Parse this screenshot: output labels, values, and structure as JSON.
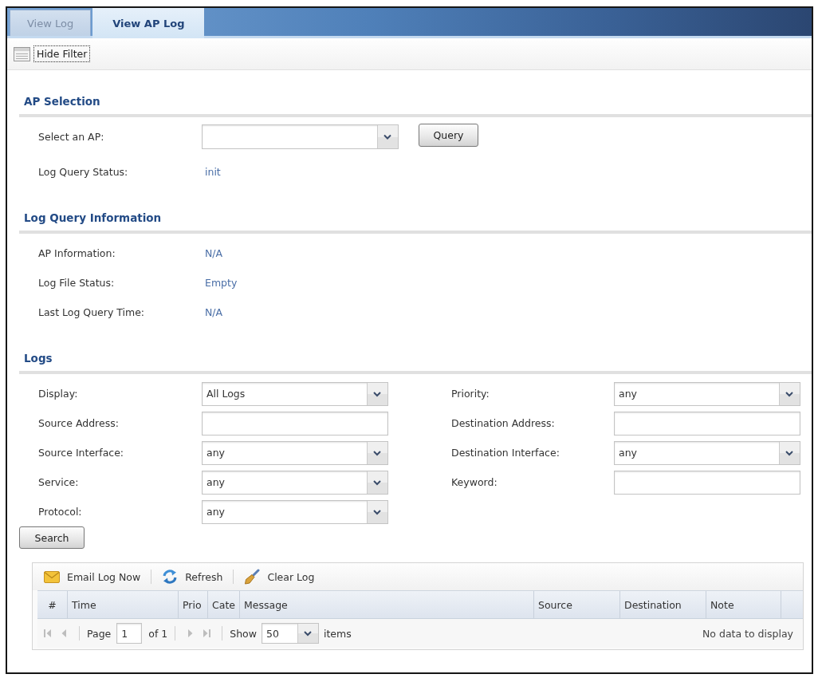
{
  "tabs": [
    {
      "label": "View Log",
      "selected": false
    },
    {
      "label": "View AP Log",
      "selected": true
    }
  ],
  "filter_toggle": {
    "label": "Hide Filter",
    "focused": true
  },
  "sections": [
    {
      "title": "AP Selection",
      "rows": [
        {
          "kind": "select",
          "label": "Select an AP:",
          "button": "Query"
        },
        {
          "kind": "text",
          "label": "Log Query Status:",
          "value": "init"
        }
      ]
    },
    {
      "title": "Log Query Information",
      "rows": [
        {
          "kind": "text",
          "label": "AP Information:",
          "value": "N/A"
        },
        {
          "kind": "text",
          "label": "Log File Status:",
          "value": "Empty"
        },
        {
          "kind": "text",
          "label": "Last Log Query Time:",
          "value": "N/A"
        }
      ]
    },
    {
      "title": "Logs",
      "filters": [
        {
          "kind": "select",
          "label": "Display:",
          "value": "All Logs"
        },
        {
          "kind": "select",
          "label": "Priority:",
          "value": "any"
        },
        {
          "kind": "input",
          "label": "Source Address:"
        },
        {
          "kind": "input",
          "label": "Destination Address:"
        },
        {
          "kind": "select",
          "label": "Source Interface:",
          "value": "any"
        },
        {
          "kind": "select",
          "label": "Destination Interface:",
          "value": "any"
        },
        {
          "kind": "select",
          "label": "Service:",
          "value": "any"
        },
        {
          "kind": "input",
          "label": "Keyword:"
        },
        {
          "kind": "select",
          "label": "Protocol:",
          "value": "any"
        }
      ],
      "search_button": "Search"
    }
  ],
  "log_table": {
    "actions": [
      {
        "kind": "email",
        "label": "Email Log Now"
      },
      {
        "kind": "refresh",
        "label": "Refresh"
      },
      {
        "kind": "clear",
        "label": "Clear Log"
      }
    ],
    "columns": [
      "#",
      "Time",
      "Prio",
      "Cate",
      "Message",
      "Source",
      "Destination",
      "Note"
    ],
    "pager": {
      "nav_disabled": true,
      "page_label": "Page",
      "page": "1",
      "page_count": "of 1",
      "show_label": "Show",
      "page_size": "50",
      "items_label": "items",
      "status": "No data to display"
    }
  }
}
